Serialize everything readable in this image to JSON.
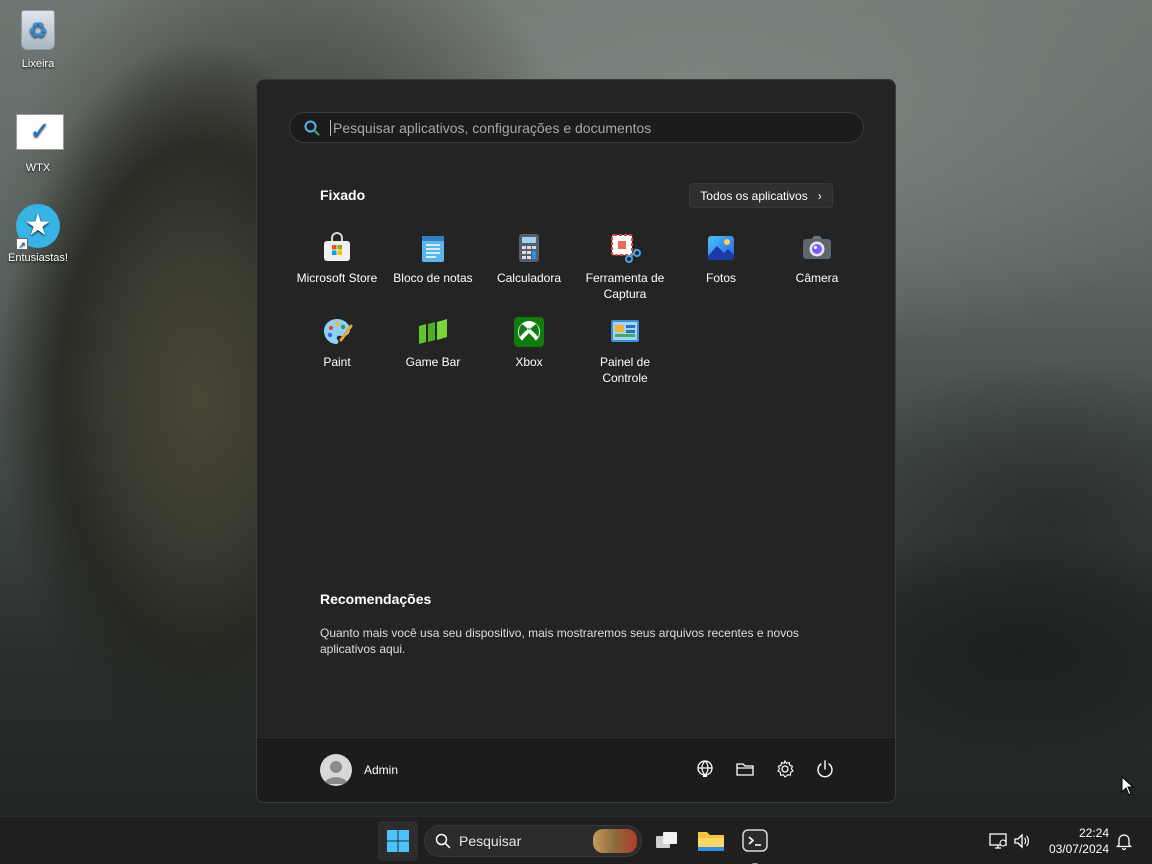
{
  "desktop": {
    "icons": [
      {
        "label": "Lixeira",
        "icon": "recycle-bin-icon"
      },
      {
        "label": "WTX",
        "icon": "checkmark-icon"
      },
      {
        "label": "Entusiastas!",
        "icon": "star-icon"
      }
    ]
  },
  "start_menu": {
    "search_placeholder": "Pesquisar aplicativos, configurações e documentos",
    "pinned_title": "Fixado",
    "all_apps_label": "Todos os aplicativos",
    "pinned_apps": [
      {
        "label": "Microsoft Store",
        "icon": "microsoft-store-icon"
      },
      {
        "label": "Bloco de notas",
        "icon": "notepad-icon"
      },
      {
        "label": "Calculadora",
        "icon": "calculator-icon"
      },
      {
        "label": "Ferramenta de Captura",
        "icon": "snipping-tool-icon"
      },
      {
        "label": "Fotos",
        "icon": "photos-icon"
      },
      {
        "label": "Câmera",
        "icon": "camera-icon"
      },
      {
        "label": "Paint",
        "icon": "paint-icon"
      },
      {
        "label": "Game Bar",
        "icon": "game-bar-icon"
      },
      {
        "label": "Xbox",
        "icon": "xbox-icon"
      },
      {
        "label": "Painel de Controle",
        "icon": "control-panel-icon"
      }
    ],
    "recommendations_title": "Recomendações",
    "recommendations_text": "Quanto mais você usa seu dispositivo, mais mostraremos seus arquivos recentes e novos aplicativos aqui.",
    "user_name": "Admin",
    "footer_icons": [
      "network-globe-icon",
      "file-explorer-folder-icon",
      "settings-gear-icon",
      "power-icon"
    ]
  },
  "taskbar": {
    "search_label": "Pesquisar",
    "time": "22:24",
    "date": "03/07/2024",
    "tray_icons": [
      "network-icon",
      "volume-icon",
      "notification-bell-icon"
    ]
  }
}
